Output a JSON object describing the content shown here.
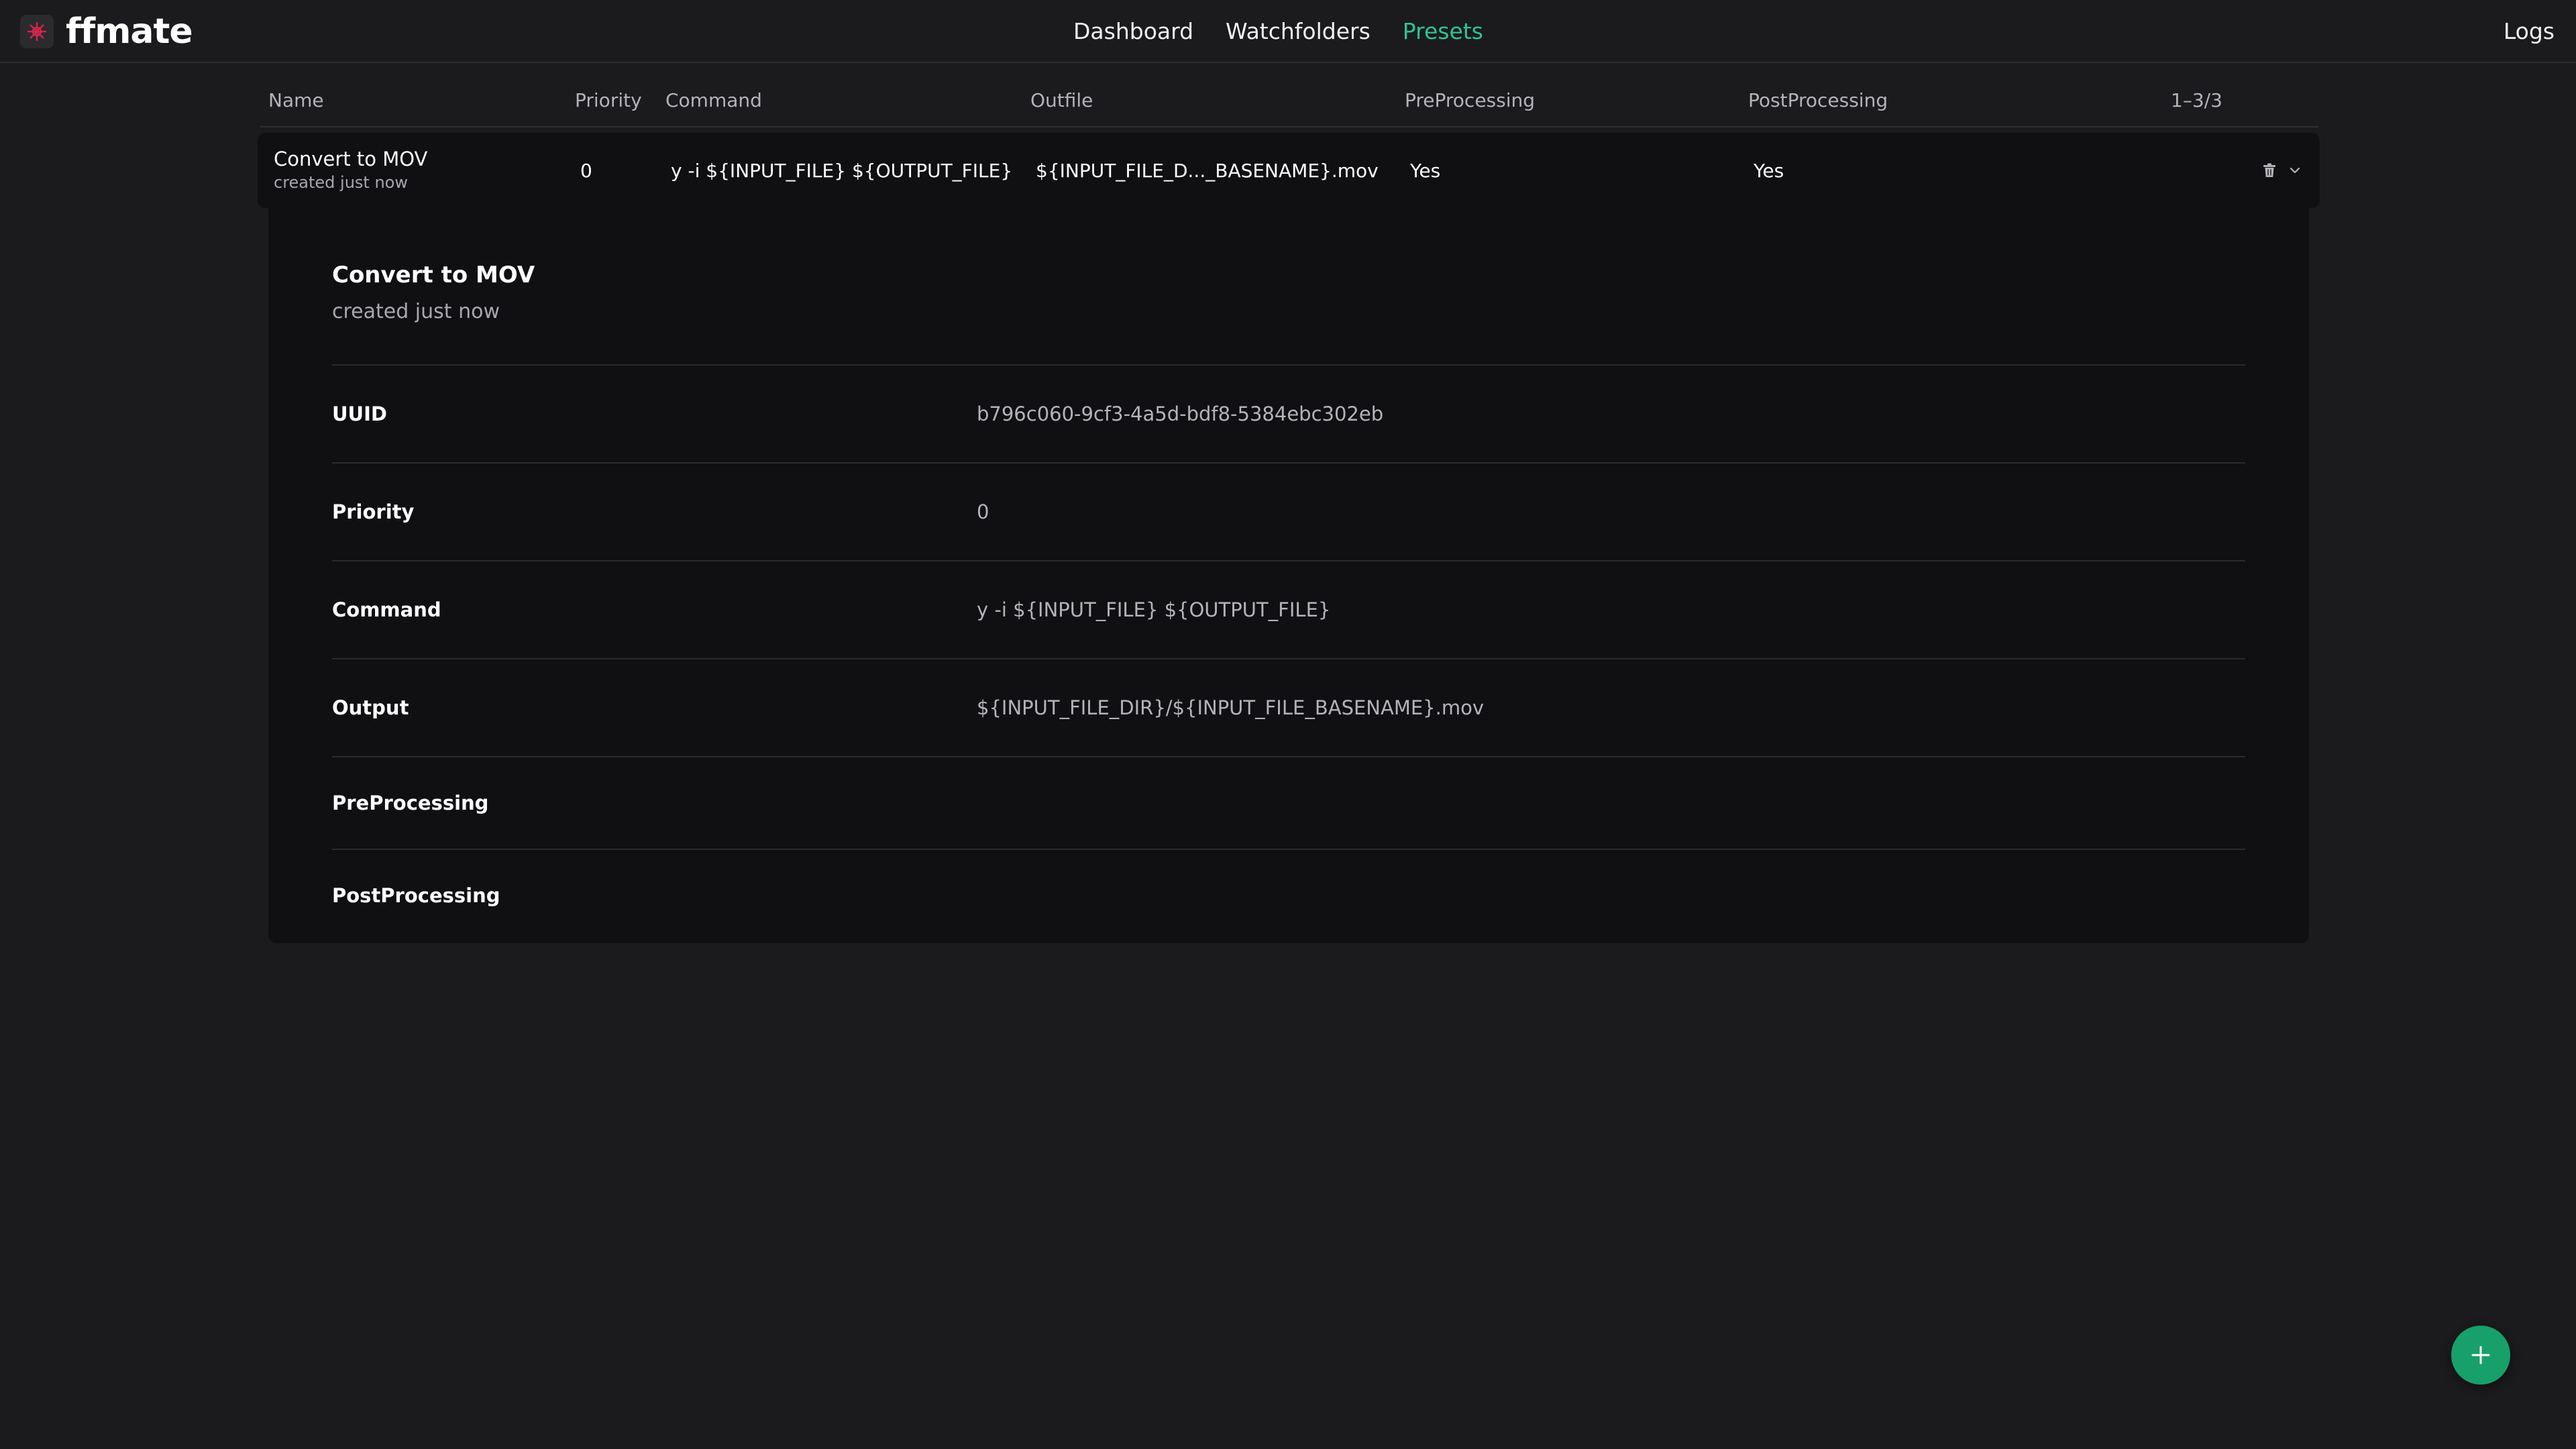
{
  "colors": {
    "background": "#1b1b1d",
    "panel": "#101012",
    "accent": "#2fc590",
    "fab": "#17a06a",
    "muted_text": "#b4b4b8"
  },
  "brand": {
    "name": "ffmate",
    "logo_icon": "ffmate-logo-icon"
  },
  "nav": {
    "items": [
      {
        "label": "Dashboard",
        "active": false
      },
      {
        "label": "Watchfolders",
        "active": false
      },
      {
        "label": "Presets",
        "active": true
      }
    ],
    "logs_label": "Logs"
  },
  "table": {
    "columns": {
      "name": "Name",
      "priority": "Priority",
      "command": "Command",
      "outfile": "Outfile",
      "preprocessing": "PreProcessing",
      "postprocessing": "PostProcessing"
    },
    "pagination": "1–3/3",
    "rows": [
      {
        "name": "Convert to MOV",
        "created": "created just now",
        "priority": "0",
        "command": "y -i ${INPUT_FILE} ${OUTPUT_FILE}",
        "outfile": "${INPUT_FILE_D..._BASENAME}.mov",
        "preprocessing": "Yes",
        "postprocessing": "Yes",
        "actions": [
          "trash-icon",
          "chevron-down-icon"
        ]
      }
    ]
  },
  "detail": {
    "title": "Convert to MOV",
    "subtitle": "created just now",
    "fields": {
      "uuid": {
        "label": "UUID",
        "value": "b796c060-9cf3-4a5d-bdf8-5384ebc302eb"
      },
      "priority": {
        "label": "Priority",
        "value": "0"
      },
      "command": {
        "label": "Command",
        "value": "y -i ${INPUT_FILE} ${OUTPUT_FILE}"
      },
      "output": {
        "label": "Output",
        "value": "${INPUT_FILE_DIR}/${INPUT_FILE_BASENAME}.mov"
      },
      "preprocessing": {
        "label": "PreProcessing",
        "value": ""
      },
      "postprocessing": {
        "label": "PostProcessing",
        "value": ""
      }
    }
  },
  "fab": {
    "icon": "plus-icon"
  }
}
